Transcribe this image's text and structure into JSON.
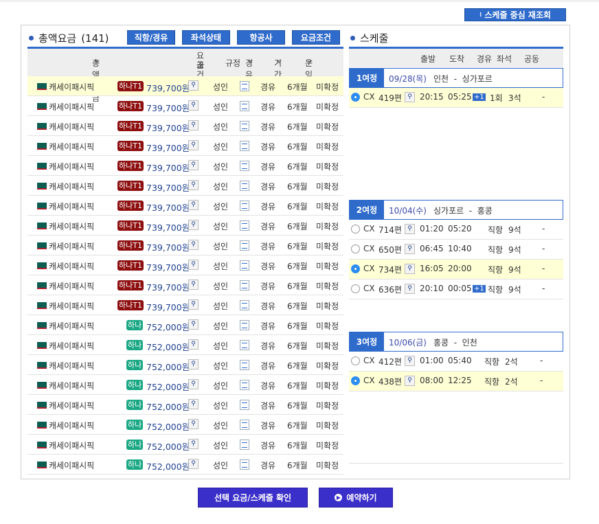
{
  "requery_button": "스케줄 중심 재조회",
  "fares": {
    "title": "총액요금",
    "count": "(141)",
    "filters": [
      "직항/경유",
      "좌석상태",
      "항공사",
      "요금조건"
    ],
    "columns": {
      "total": "총액요금",
      "cond1": "요금",
      "cond2": "조건",
      "rule": "규정",
      "via": "경유",
      "period": "기간",
      "status": "운임"
    },
    "rows": [
      {
        "airline": "캐세이패시픽",
        "badge": "하나T1",
        "price": "739,700원",
        "pax": "성인",
        "via": "경유",
        "period": "6개월",
        "status": "미확정",
        "selected": true
      },
      {
        "airline": "캐세이패시픽",
        "badge": "하나T1",
        "price": "739,700원",
        "pax": "성인",
        "via": "경유",
        "period": "6개월",
        "status": "미확정"
      },
      {
        "airline": "캐세이패시픽",
        "badge": "하나T1",
        "price": "739,700원",
        "pax": "성인",
        "via": "경유",
        "period": "6개월",
        "status": "미확정"
      },
      {
        "airline": "캐세이패시픽",
        "badge": "하나T1",
        "price": "739,700원",
        "pax": "성인",
        "via": "경유",
        "period": "6개월",
        "status": "미확정"
      },
      {
        "airline": "캐세이패시픽",
        "badge": "하나T1",
        "price": "739,700원",
        "pax": "성인",
        "via": "경유",
        "period": "6개월",
        "status": "미확정"
      },
      {
        "airline": "캐세이패시픽",
        "badge": "하나T1",
        "price": "739,700원",
        "pax": "성인",
        "via": "경유",
        "period": "6개월",
        "status": "미확정"
      },
      {
        "airline": "캐세이패시픽",
        "badge": "하나T1",
        "price": "739,700원",
        "pax": "성인",
        "via": "경유",
        "period": "6개월",
        "status": "미확정"
      },
      {
        "airline": "캐세이패시픽",
        "badge": "하나T1",
        "price": "739,700원",
        "pax": "성인",
        "via": "경유",
        "period": "6개월",
        "status": "미확정"
      },
      {
        "airline": "캐세이패시픽",
        "badge": "하나T1",
        "price": "739,700원",
        "pax": "성인",
        "via": "경유",
        "period": "6개월",
        "status": "미확정"
      },
      {
        "airline": "캐세이패시픽",
        "badge": "하나T1",
        "price": "739,700원",
        "pax": "성인",
        "via": "경유",
        "period": "6개월",
        "status": "미확정"
      },
      {
        "airline": "캐세이패시픽",
        "badge": "하나T1",
        "price": "739,700원",
        "pax": "성인",
        "via": "경유",
        "period": "6개월",
        "status": "미확정"
      },
      {
        "airline": "캐세이패시픽",
        "badge": "하나T1",
        "price": "739,700원",
        "pax": "성인",
        "via": "경유",
        "period": "6개월",
        "status": "미확정"
      },
      {
        "airline": "캐세이패시픽",
        "badge": "하나",
        "price": "752,000원",
        "pax": "성인",
        "via": "경유",
        "period": "6개월",
        "status": "미확정"
      },
      {
        "airline": "캐세이패시픽",
        "badge": "하나",
        "price": "752,000원",
        "pax": "성인",
        "via": "경유",
        "period": "6개월",
        "status": "미확정"
      },
      {
        "airline": "캐세이패시픽",
        "badge": "하나",
        "price": "752,000원",
        "pax": "성인",
        "via": "경유",
        "period": "6개월",
        "status": "미확정"
      },
      {
        "airline": "캐세이패시픽",
        "badge": "하나",
        "price": "752,000원",
        "pax": "성인",
        "via": "경유",
        "period": "6개월",
        "status": "미확정"
      },
      {
        "airline": "캐세이패시픽",
        "badge": "하나",
        "price": "752,000원",
        "pax": "성인",
        "via": "경유",
        "period": "6개월",
        "status": "미확정"
      },
      {
        "airline": "캐세이패시픽",
        "badge": "하나",
        "price": "752,000원",
        "pax": "성인",
        "via": "경유",
        "period": "6개월",
        "status": "미확정"
      },
      {
        "airline": "캐세이패시픽",
        "badge": "하나",
        "price": "752,000원",
        "pax": "성인",
        "via": "경유",
        "period": "6개월",
        "status": "미확정"
      },
      {
        "airline": "캐세이패시픽",
        "badge": "하나",
        "price": "752,000원",
        "pax": "성인",
        "via": "경유",
        "period": "6개월",
        "status": "미확정"
      }
    ]
  },
  "schedule": {
    "title": "스케줄",
    "columns": {
      "dep": "출발",
      "arr": "도착",
      "via": "경유",
      "seats": "좌석",
      "codeshare": "공동"
    },
    "segments": [
      {
        "label": "1여정",
        "date": "09/28(목)",
        "route": "인천  -  싱가포르",
        "flights": [
          {
            "carrier": "CX",
            "flight": "419편",
            "dep": "20:15",
            "arr": "05:25",
            "plus": "+1",
            "via": "1회",
            "seats": "3석",
            "codeshare": "-",
            "selected": true
          }
        ]
      },
      {
        "label": "2여정",
        "date": "10/04(수)",
        "route": "싱가포르  -  홍콩",
        "flights": [
          {
            "carrier": "CX",
            "flight": "714편",
            "dep": "01:20",
            "arr": "05:20",
            "via": "직항",
            "seats": "9석",
            "codeshare": "-"
          },
          {
            "carrier": "CX",
            "flight": "650편",
            "dep": "06:45",
            "arr": "10:40",
            "via": "직항",
            "seats": "9석",
            "codeshare": "-"
          },
          {
            "carrier": "CX",
            "flight": "734편",
            "dep": "16:05",
            "arr": "20:00",
            "via": "직항",
            "seats": "9석",
            "codeshare": "-",
            "selected": true
          },
          {
            "carrier": "CX",
            "flight": "636편",
            "dep": "20:10",
            "arr": "00:05",
            "plus": "+1",
            "via": "직항",
            "seats": "9석",
            "codeshare": "-"
          }
        ]
      },
      {
        "label": "3여정",
        "date": "10/06(금)",
        "route": "홍콩  -  인천",
        "flights": [
          {
            "carrier": "CX",
            "flight": "412편",
            "dep": "01:00",
            "arr": "05:40",
            "via": "직항",
            "seats": "2석",
            "codeshare": "-"
          },
          {
            "carrier": "CX",
            "flight": "438편",
            "dep": "08:00",
            "arr": "12:25",
            "via": "직항",
            "seats": "2석",
            "codeshare": "-",
            "selected": true
          }
        ]
      }
    ]
  },
  "actions": {
    "confirm": "선택 요금/스케줄 확인",
    "book": "예약하기"
  },
  "colors": {
    "accent": "#2f6bcb",
    "action": "#3b2fc9",
    "selected_row": "#ffffd6",
    "badge_t1": "#8e0f10",
    "badge_hana": "#19a784"
  }
}
